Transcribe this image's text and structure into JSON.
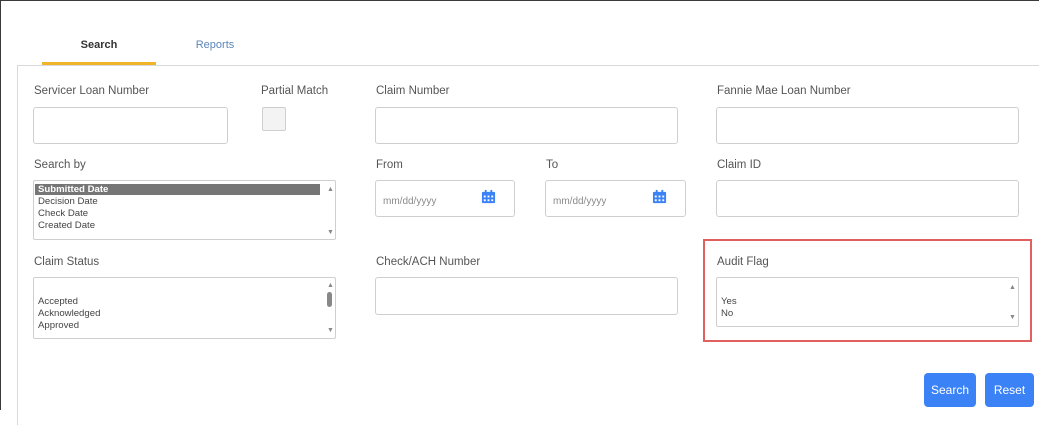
{
  "tabs": {
    "search": "Search",
    "reports": "Reports"
  },
  "fields": {
    "servicer_loan_number": {
      "label": "Servicer Loan Number",
      "value": ""
    },
    "partial_match": {
      "label": "Partial Match"
    },
    "claim_number": {
      "label": "Claim Number",
      "value": ""
    },
    "fannie_mae_loan_number": {
      "label": "Fannie Mae Loan Number",
      "value": ""
    },
    "search_by": {
      "label": "Search by",
      "options": [
        "Submitted Date",
        "Decision Date",
        "Check Date",
        "Created Date"
      ],
      "selected": "Submitted Date"
    },
    "from": {
      "label": "From",
      "placeholder": "mm/dd/yyyy"
    },
    "to": {
      "label": "To",
      "placeholder": "mm/dd/yyyy"
    },
    "claim_id": {
      "label": "Claim ID",
      "value": ""
    },
    "claim_status": {
      "label": "Claim Status",
      "options": [
        "Accepted",
        "Acknowledged",
        "Approved"
      ]
    },
    "check_ach_number": {
      "label": "Check/ACH Number",
      "value": ""
    },
    "audit_flag": {
      "label": "Audit Flag",
      "options": [
        "Yes",
        "No"
      ]
    }
  },
  "buttons": {
    "search": "Search",
    "reset": "Reset"
  },
  "colors": {
    "primary_button": "#3b82f6",
    "active_tab_underline": "#f0b429",
    "highlight": "#e06060"
  },
  "icons": {
    "date_picker": "calendar-icon",
    "scroll_up": "scroll-up-arrow-icon",
    "scroll_down": "scroll-down-arrow-icon"
  }
}
